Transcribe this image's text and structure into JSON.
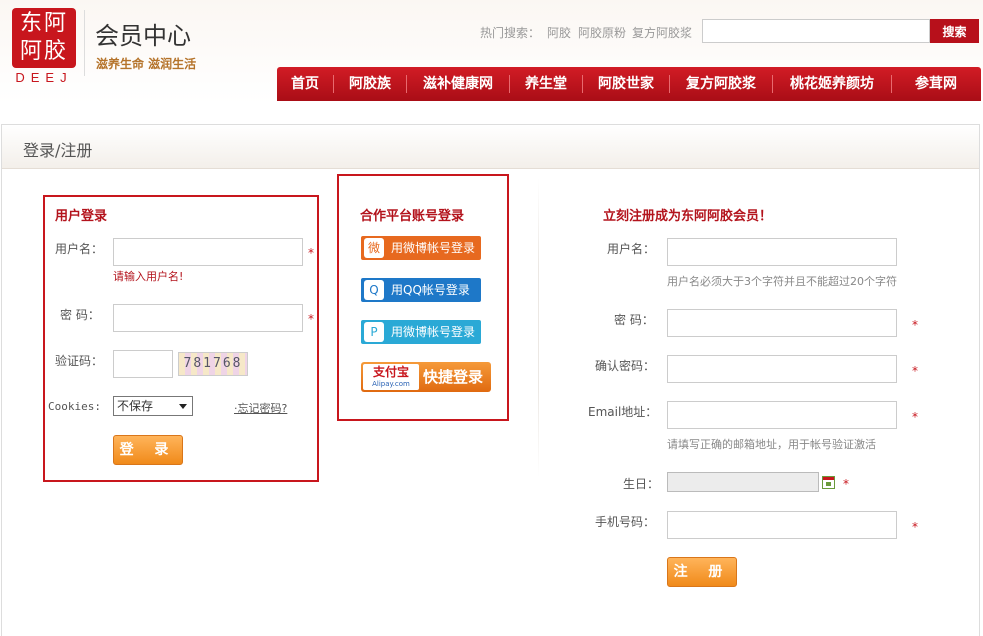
{
  "header": {
    "logo_chars": "东阿阿胶",
    "logo_deej": "DEEJ",
    "title": "会员中心",
    "slogan": "滋养生命 滋润生活",
    "hot_label": "热门搜索：",
    "hot_links": [
      "阿胶",
      "阿胶原粉",
      "复方阿胶浆"
    ],
    "search_placeholder": "",
    "search_button": "搜索"
  },
  "nav": [
    "首页",
    "阿胶族",
    "滋补健康网",
    "养生堂",
    "阿胶世家",
    "复方阿胶浆",
    "桃花姬养颜坊",
    "参茸网"
  ],
  "panel": {
    "title": "登录/注册"
  },
  "login": {
    "title": "用户登录",
    "username_label": "用户名：",
    "username_error": "请输入用户名!",
    "password_label": "密  码：",
    "captcha_label": "验证码：",
    "captcha_value": "781768",
    "cookies_label": "Cookies:",
    "cookies_selected": "不保存",
    "forgot": "·忘记密码?",
    "submit": "登 录",
    "star": "*"
  },
  "partner": {
    "title": "合作平台账号登录",
    "buttons": [
      {
        "label": "用微博帐号登录",
        "color": "#e7691f",
        "icon": "微"
      },
      {
        "label": "用QQ帐号登录",
        "color": "#1e78c8",
        "icon": "Q"
      },
      {
        "label": "用微博帐号登录",
        "color": "#2aa9d6",
        "icon": "P"
      }
    ],
    "alipay_logo": "支付宝",
    "alipay_sub": "Alipay.com",
    "alipay_label": "快捷登录"
  },
  "register": {
    "title": "立刻注册成为东阿阿胶会员！",
    "username_label": "用户名：",
    "username_hint": "用户名必须大于3个字符并且不能超过20个字符",
    "password_label": "密  码：",
    "confirm_label": "确认密码：",
    "email_label": "Email地址：",
    "email_hint": "请填写正确的邮箱地址，用于帐号验证激活",
    "birthday_label": "生日：",
    "phone_label": "手机号码：",
    "submit": "注 册",
    "star": "*"
  }
}
